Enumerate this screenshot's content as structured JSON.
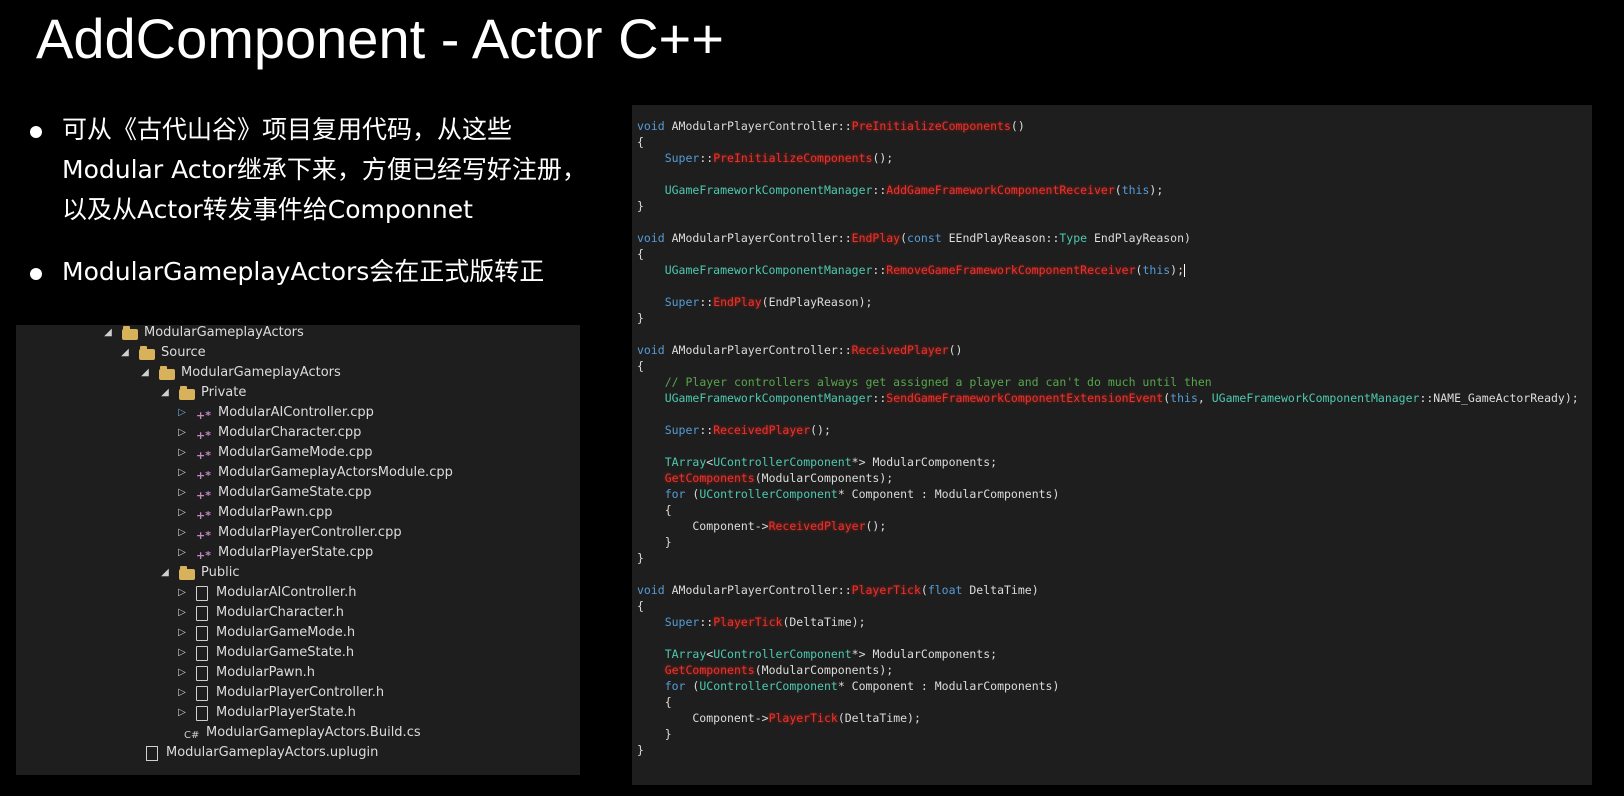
{
  "slide": {
    "title": "AddComponent - Actor C++",
    "bullets": [
      {
        "lines": [
          "可从《古代山谷》项目复用代码，从这些",
          "Modular Actor继承下来，方便已经写好注册，",
          "以及从Actor转发事件给Componnet"
        ]
      },
      {
        "lines": [
          "ModularGameplayActors会在正式版转正"
        ]
      }
    ]
  },
  "explorer": {
    "items": [
      {
        "label": "ModularGameplayActors",
        "icon": "folder-icon",
        "expanded": true
      },
      {
        "label": "Source",
        "icon": "folder-icon",
        "expanded": true
      },
      {
        "label": "ModularGameplayActors",
        "icon": "folder-icon",
        "expanded": true
      },
      {
        "label": "Private",
        "icon": "folder-icon",
        "expanded": true
      },
      {
        "label": "ModularAIController.cpp",
        "icon": "cpp-file-icon"
      },
      {
        "label": "ModularCharacter.cpp",
        "icon": "cpp-file-icon"
      },
      {
        "label": "ModularGameMode.cpp",
        "icon": "cpp-file-icon"
      },
      {
        "label": "ModularGameplayActorsModule.cpp",
        "icon": "cpp-file-icon"
      },
      {
        "label": "ModularGameState.cpp",
        "icon": "cpp-file-icon"
      },
      {
        "label": "ModularPawn.cpp",
        "icon": "cpp-file-icon"
      },
      {
        "label": "ModularPlayerController.cpp",
        "icon": "cpp-file-icon"
      },
      {
        "label": "ModularPlayerState.cpp",
        "icon": "cpp-file-icon"
      },
      {
        "label": "Public",
        "icon": "folder-icon",
        "expanded": true
      },
      {
        "label": "ModularAIController.h",
        "icon": "header-file-icon"
      },
      {
        "label": "ModularCharacter.h",
        "icon": "header-file-icon"
      },
      {
        "label": "ModularGameMode.h",
        "icon": "header-file-icon"
      },
      {
        "label": "ModularGameState.h",
        "icon": "header-file-icon"
      },
      {
        "label": "ModularPawn.h",
        "icon": "header-file-icon"
      },
      {
        "label": "ModularPlayerController.h",
        "icon": "header-file-icon"
      },
      {
        "label": "ModularPlayerState.h",
        "icon": "header-file-icon"
      },
      {
        "label": "ModularGameplayActors.Build.cs",
        "icon": "csharp-file-icon"
      },
      {
        "label": "ModularGameplayActors.uplugin",
        "icon": "plugin-file-icon"
      }
    ]
  },
  "code": {
    "lines": [
      "void AModularPlayerController::PreInitializeComponents()",
      "{",
      "    Super::PreInitializeComponents();",
      "",
      "    UGameFrameworkComponentManager::AddGameFrameworkComponentReceiver(this);",
      "}",
      "",
      "void AModularPlayerController::EndPlay(const EEndPlayReason::Type EndPlayReason)",
      "{",
      "    UGameFrameworkComponentManager::RemoveGameFrameworkComponentReceiver(this);",
      "",
      "    Super::EndPlay(EndPlayReason);",
      "}",
      "",
      "void AModularPlayerController::ReceivedPlayer()",
      "{",
      "    // Player controllers always get assigned a player and can't do much until then",
      "    UGameFrameworkComponentManager::SendGameFrameworkComponentExtensionEvent(this, UGameFrameworkComponentManager::NAME_GameActorReady);",
      "",
      "    Super::ReceivedPlayer();",
      "",
      "    TArray<UControllerComponent*> ModularComponents;",
      "    GetComponents(ModularComponents);",
      "    for (UControllerComponent* Component : ModularComponents)",
      "    {",
      "        Component->ReceivedPlayer();",
      "    }",
      "}",
      "",
      "void AModularPlayerController::PlayerTick(float DeltaTime)",
      "{",
      "    Super::PlayerTick(DeltaTime);",
      "",
      "    TArray<UControllerComponent*> ModularComponents;",
      "    GetComponents(ModularComponents);",
      "    for (UControllerComponent* Component : ModularComponents)",
      "    {",
      "        Component->PlayerTick(DeltaTime);",
      "    }",
      "}"
    ]
  }
}
